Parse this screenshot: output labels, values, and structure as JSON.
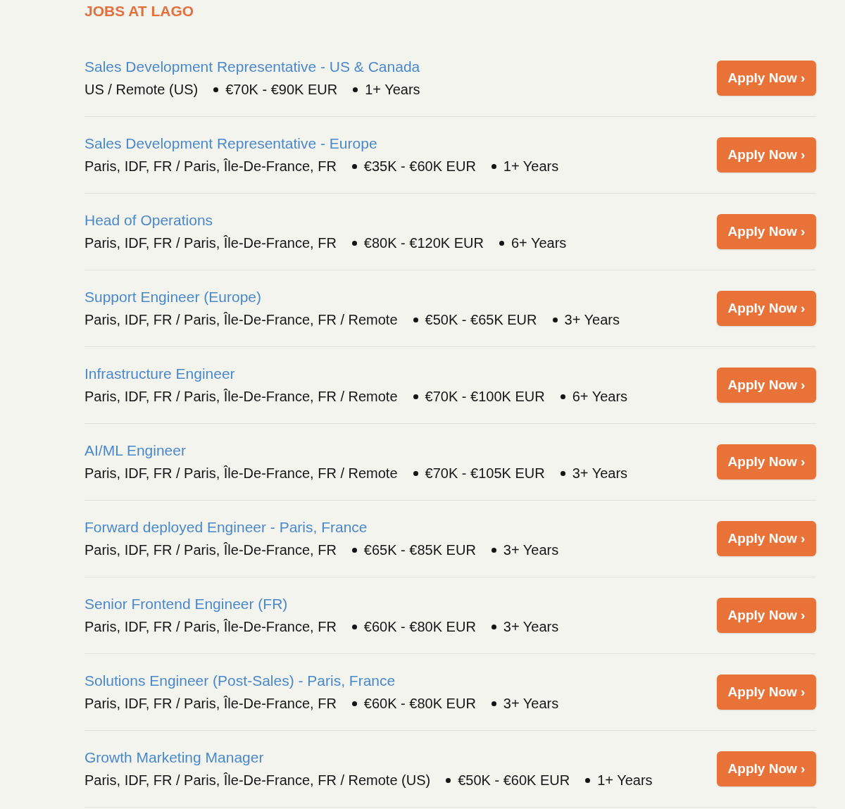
{
  "heading": "JOBS AT LAGO",
  "jobs": [
    {
      "title": "Sales Development Representative - US & Canada",
      "location": "US / Remote (US)",
      "salary": "€70K - €90K EUR",
      "experience": "1+ Years",
      "button": "Apply Now ›"
    },
    {
      "title": "Sales Development Representative - Europe",
      "location": "Paris, IDF, FR / Paris, Île-De-France, FR",
      "salary": "€35K - €60K EUR",
      "experience": "1+ Years",
      "button": "Apply Now ›"
    },
    {
      "title": "Head of Operations",
      "location": "Paris, IDF, FR / Paris, Île-De-France, FR",
      "salary": "€80K - €120K EUR",
      "experience": "6+ Years",
      "button": "Apply Now ›"
    },
    {
      "title": "Support Engineer (Europe)",
      "location": "Paris, IDF, FR / Paris, Île-De-France, FR / Remote",
      "salary": "€50K - €65K EUR",
      "experience": "3+ Years",
      "button": "Apply Now ›"
    },
    {
      "title": "Infrastructure Engineer",
      "location": "Paris, IDF, FR / Paris, Île-De-France, FR / Remote",
      "salary": "€70K - €100K EUR",
      "experience": "6+ Years",
      "button": "Apply Now ›"
    },
    {
      "title": "AI/ML Engineer",
      "location": "Paris, IDF, FR / Paris, Île-De-France, FR / Remote",
      "salary": "€70K - €105K EUR",
      "experience": "3+ Years",
      "button": "Apply Now ›"
    },
    {
      "title": "Forward deployed Engineer - Paris, France",
      "location": "Paris, IDF, FR / Paris, Île-De-France, FR",
      "salary": "€65K - €85K EUR",
      "experience": "3+ Years",
      "button": "Apply Now ›"
    },
    {
      "title": "Senior Frontend Engineer (FR)",
      "location": "Paris, IDF, FR / Paris, Île-De-France, FR",
      "salary": "€60K - €80K EUR",
      "experience": "3+ Years",
      "button": "Apply Now ›"
    },
    {
      "title": "Solutions Engineer (Post-Sales) - Paris, France",
      "location": "Paris, IDF, FR / Paris, Île-De-France, FR",
      "salary": "€60K - €80K EUR",
      "experience": "3+ Years",
      "button": "Apply Now ›"
    },
    {
      "title": "Growth Marketing Manager",
      "location": "Paris, IDF, FR / Paris, Île-De-France, FR / Remote (US)",
      "salary": "€50K - €60K EUR",
      "experience": "1+ Years",
      "button": "Apply Now ›"
    }
  ]
}
